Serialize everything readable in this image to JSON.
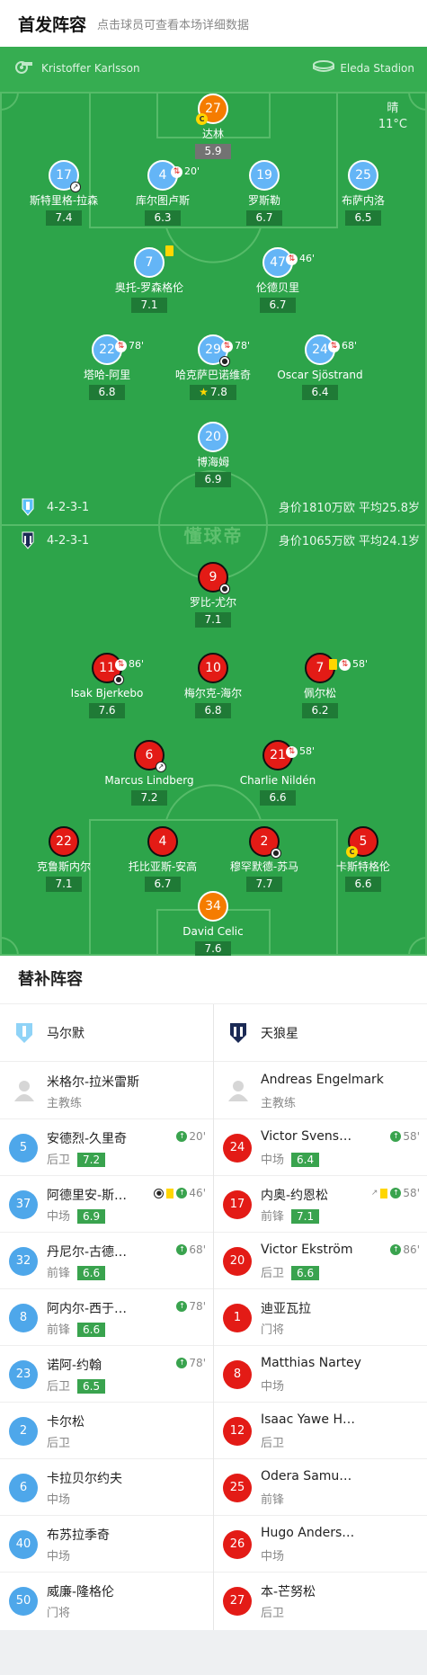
{
  "header": {
    "title": "首发阵容",
    "subtitle": "点击球员可查看本场详细数据"
  },
  "pitch": {
    "referee": "Kristoffer Karlsson",
    "venue": "Eleda Stadion",
    "weather": "晴",
    "temperature": "11°C",
    "brand": "懂球帝",
    "home": {
      "formation": "4-2-3-1",
      "value": "身价1810万欧 平均25.8岁",
      "color": "#5bc0f8"
    },
    "away": {
      "formation": "4-2-3-1",
      "value": "身价1065万欧 平均24.1岁",
      "color": "#1b2a55"
    }
  },
  "players": [
    {
      "num": "27",
      "name": "达林",
      "rating": "5.9",
      "captain": "C"
    },
    {
      "num": "17",
      "name": "斯特里格-拉森",
      "rating": "7.4"
    },
    {
      "num": "4",
      "name": "库尔图卢斯",
      "rating": "6.3",
      "sub": "20'"
    },
    {
      "num": "19",
      "name": "罗斯勒",
      "rating": "6.7"
    },
    {
      "num": "25",
      "name": "布萨内洛",
      "rating": "6.5"
    },
    {
      "num": "7",
      "name": "奥托-罗森格伦",
      "rating": "7.1"
    },
    {
      "num": "47",
      "name": "伦德贝里",
      "rating": "6.7",
      "sub": "46'"
    },
    {
      "num": "22",
      "name": "塔哈-阿里",
      "rating": "6.8",
      "sub": "78'"
    },
    {
      "num": "29",
      "name": "哈克萨巴诺维奇",
      "rating": "7.8",
      "sub": "78'"
    },
    {
      "num": "24",
      "name": "Oscar Sjöstrand",
      "rating": "6.4",
      "sub": "68'"
    },
    {
      "num": "20",
      "name": "博海姆",
      "rating": "6.9"
    },
    {
      "num": "9",
      "name": "罗比-尤尔",
      "rating": "7.1"
    },
    {
      "num": "11",
      "name": "Isak Bjerkebo",
      "rating": "7.6",
      "sub": "86'"
    },
    {
      "num": "10",
      "name": "梅尔克-海尔",
      "rating": "6.8"
    },
    {
      "num": "7",
      "name": "佩尔松",
      "rating": "6.2",
      "sub": "58'"
    },
    {
      "num": "6",
      "name": "Marcus Lindberg",
      "rating": "7.2"
    },
    {
      "num": "21",
      "name": "Charlie Nildén",
      "rating": "6.6",
      "sub": "58'"
    },
    {
      "num": "22",
      "name": "克鲁斯内尔",
      "rating": "7.1"
    },
    {
      "num": "4",
      "name": "托比亚斯-安高",
      "rating": "6.7"
    },
    {
      "num": "2",
      "name": "穆罕默德-苏马",
      "rating": "7.7"
    },
    {
      "num": "5",
      "name": "卡斯特格伦",
      "rating": "6.6",
      "captain": "C"
    },
    {
      "num": "34",
      "name": "David Celic",
      "rating": "7.6"
    }
  ],
  "bench": {
    "title": "替补阵容",
    "home": {
      "team": "马尔默",
      "coach": {
        "name": "米格尔-拉米雷斯",
        "role": "主教练"
      },
      "subs": [
        {
          "num": "5",
          "name": "安德烈-久里奇",
          "pos": "后卫",
          "rating": "7.2",
          "time": "20'"
        },
        {
          "num": "37",
          "name": "阿德里安-斯…",
          "pos": "中场",
          "rating": "6.9",
          "time": "46'"
        },
        {
          "num": "32",
          "name": "丹尼尔-古德…",
          "pos": "前锋",
          "rating": "6.6",
          "time": "68'"
        },
        {
          "num": "8",
          "name": "阿内尔-西于…",
          "pos": "前锋",
          "rating": "6.6",
          "time": "78'"
        },
        {
          "num": "23",
          "name": "诺阿-约翰",
          "pos": "后卫",
          "rating": "6.5",
          "time": "78'"
        },
        {
          "num": "2",
          "name": "卡尔松",
          "pos": "后卫"
        },
        {
          "num": "6",
          "name": "卡拉贝尔约夫",
          "pos": "中场"
        },
        {
          "num": "40",
          "name": "布苏拉季奇",
          "pos": "中场"
        },
        {
          "num": "50",
          "name": "威廉-隆格伦",
          "pos": "门将"
        }
      ]
    },
    "away": {
      "team": "天狼星",
      "coach": {
        "name": "Andreas Engelmark",
        "role": "主教练"
      },
      "subs": [
        {
          "num": "24",
          "name": "Victor Svens…",
          "pos": "中场",
          "rating": "6.4",
          "time": "58'"
        },
        {
          "num": "17",
          "name": "内奥-约恩松",
          "pos": "前锋",
          "rating": "7.1",
          "time": "58'"
        },
        {
          "num": "20",
          "name": "Victor Ekström",
          "pos": "后卫",
          "rating": "6.6",
          "time": "86'"
        },
        {
          "num": "1",
          "name": "迪亚瓦拉",
          "pos": "门将"
        },
        {
          "num": "8",
          "name": "Matthias Nartey",
          "pos": "中场"
        },
        {
          "num": "12",
          "name": "Isaac Yawe H…",
          "pos": "后卫"
        },
        {
          "num": "25",
          "name": "Odera Samu…",
          "pos": "前锋"
        },
        {
          "num": "26",
          "name": "Hugo Anders…",
          "pos": "中场"
        },
        {
          "num": "27",
          "name": "本-芒努松",
          "pos": "后卫"
        }
      ]
    }
  }
}
